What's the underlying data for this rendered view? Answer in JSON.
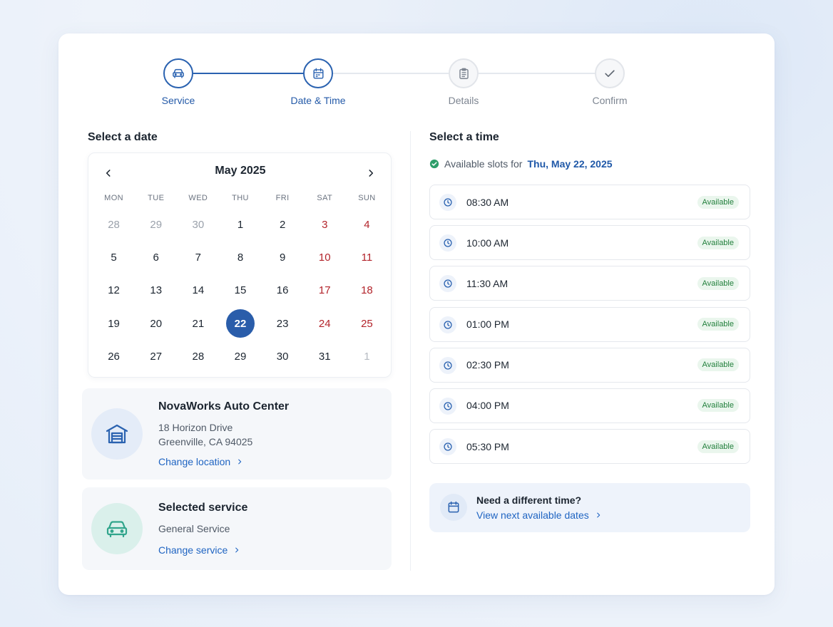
{
  "stepper": {
    "steps": [
      {
        "label": "Service",
        "state": "completed"
      },
      {
        "label": "Date & Time",
        "state": "current"
      },
      {
        "label": "Details",
        "state": "pending"
      },
      {
        "label": "Confirm",
        "state": "pending"
      }
    ]
  },
  "date_section": {
    "title": "Select a date",
    "calendar": {
      "month_label": "May 2025",
      "prev_icon": "chevron-left-icon",
      "next_icon": "chevron-right-icon",
      "weekdays": [
        "MON",
        "TUE",
        "WED",
        "THU",
        "FRI",
        "SAT",
        "SUN"
      ],
      "days": [
        {
          "d": "28",
          "muted": true,
          "weekend": false
        },
        {
          "d": "29",
          "muted": true,
          "weekend": false
        },
        {
          "d": "30",
          "muted": true,
          "weekend": false
        },
        {
          "d": "1",
          "muted": false,
          "weekend": false
        },
        {
          "d": "2",
          "muted": false,
          "weekend": false
        },
        {
          "d": "3",
          "muted": false,
          "weekend": true
        },
        {
          "d": "4",
          "muted": false,
          "weekend": true
        },
        {
          "d": "5",
          "muted": false,
          "weekend": false
        },
        {
          "d": "6",
          "muted": false,
          "weekend": false
        },
        {
          "d": "7",
          "muted": false,
          "weekend": false
        },
        {
          "d": "8",
          "muted": false,
          "weekend": false
        },
        {
          "d": "9",
          "muted": false,
          "weekend": false
        },
        {
          "d": "10",
          "muted": false,
          "weekend": true
        },
        {
          "d": "11",
          "muted": false,
          "weekend": true
        },
        {
          "d": "12",
          "muted": false,
          "weekend": false
        },
        {
          "d": "13",
          "muted": false,
          "weekend": false
        },
        {
          "d": "14",
          "muted": false,
          "weekend": false
        },
        {
          "d": "15",
          "muted": false,
          "weekend": false
        },
        {
          "d": "16",
          "muted": false,
          "weekend": false
        },
        {
          "d": "17",
          "muted": false,
          "weekend": true
        },
        {
          "d": "18",
          "muted": false,
          "weekend": true
        },
        {
          "d": "19",
          "muted": false,
          "weekend": false
        },
        {
          "d": "20",
          "muted": false,
          "weekend": false
        },
        {
          "d": "21",
          "muted": false,
          "weekend": false
        },
        {
          "d": "22",
          "muted": false,
          "weekend": false,
          "selected": true
        },
        {
          "d": "23",
          "muted": false,
          "weekend": false
        },
        {
          "d": "24",
          "muted": false,
          "weekend": true
        },
        {
          "d": "25",
          "muted": false,
          "weekend": true
        },
        {
          "d": "26",
          "muted": false,
          "weekend": false
        },
        {
          "d": "27",
          "muted": false,
          "weekend": false
        },
        {
          "d": "28",
          "muted": false,
          "weekend": false
        },
        {
          "d": "29",
          "muted": false,
          "weekend": false
        },
        {
          "d": "30",
          "muted": false,
          "weekend": false
        },
        {
          "d": "31",
          "muted": false,
          "weekend": false
        },
        {
          "d": "1",
          "muted": true,
          "weekend": true
        }
      ]
    }
  },
  "location": {
    "name": "NovaWorks Auto Center",
    "address_line1": "18 Horizon Drive",
    "address_line2": "Greenville, CA 94025",
    "change_label": "Change location",
    "icon": "garage-icon"
  },
  "service": {
    "title": "Selected service",
    "name": "General Service",
    "change_label": "Change service",
    "icon": "car-icon"
  },
  "time_section": {
    "title": "Select a time",
    "available_prefix": "Available slots for",
    "available_date": "Thu, May 22, 2025",
    "slots": [
      {
        "time": "08:30 AM",
        "status": "Available"
      },
      {
        "time": "10:00 AM",
        "status": "Available"
      },
      {
        "time": "11:30 AM",
        "status": "Available"
      },
      {
        "time": "01:00 PM",
        "status": "Available"
      },
      {
        "time": "02:30 PM",
        "status": "Available"
      },
      {
        "time": "04:00 PM",
        "status": "Available"
      },
      {
        "time": "05:30 PM",
        "status": "Available"
      }
    ],
    "help": {
      "title": "Need a different time?",
      "link": "View next available dates",
      "icon": "calendar-icon"
    }
  },
  "colors": {
    "primary": "#2a5daa",
    "link": "#1f64c2",
    "weekend": "#b3242b",
    "available": "#23803d",
    "success": "#2e9e6a"
  }
}
